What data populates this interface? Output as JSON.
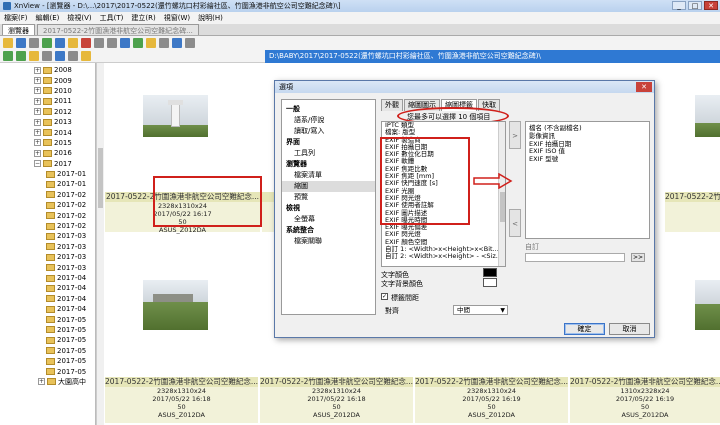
{
  "window": {
    "title": "XnView - [瀏覽器 - D:\\...\\2017\\2017-0522(還竹螺坑口村彩繪社區、竹圍漁港非航空公司空難紀念碑)\\]",
    "controls": [
      "_",
      "□",
      "✕"
    ]
  },
  "menu": [
    "檔案(F)",
    "編輯(E)",
    "檢視(V)",
    "工具(T)",
    "建立(R)",
    "視窗(W)",
    "說明(H)"
  ],
  "tabs": [
    "瀏覽器",
    "2017-0522-2竹圍漁港非航空公司空難紀念碑..."
  ],
  "address": "D:\\BABY\\2017\\2017-0522(還竹螺坑口村彩繪社區、竹圍漁港非航空公司空難紀念碑)\\",
  "tree": {
    "years": [
      "2008",
      "2009",
      "2010",
      "2011",
      "2012",
      "2013",
      "2014",
      "2015",
      "2016",
      "2017"
    ],
    "subfolders": [
      "2017-01",
      "2017-01",
      "2017-02",
      "2017-02",
      "2017-02",
      "2017-02",
      "2017-03",
      "2017-03",
      "2017-03",
      "2017-03",
      "2017-04",
      "2017-04",
      "2017-04",
      "2017-04",
      "2017-05",
      "2017-05",
      "2017-05",
      "2017-05",
      "2017-05",
      "2017-05",
      "大園高中"
    ]
  },
  "thumbnails": [
    {
      "name": "2017-0522-2竹圍漁港非航空公司空難紀念...",
      "dims": "2328x1310x24",
      "date": "2017/05/22 16:17",
      "num": "50",
      "model": "ASUS_Z012DA"
    },
    {
      "name": "2017-0522-2竹圍漁港非航空公司空難紀念...",
      "dims": "2328x1310x24",
      "date": "2017/05/22 16:18",
      "num": "50",
      "model": "ASUS_Z012DA"
    },
    {
      "name": "2017-0522-2竹圍漁港非航空公司空難紀念...",
      "dims": "2328x1310x24",
      "date": "2017/05/22 16:18",
      "num": "50",
      "model": "ASUS_Z012DA"
    },
    {
      "name": "2017-0522-2竹圍漁港非航空公司空難紀念...",
      "dims": "2328x1310x24",
      "date": "2017/05/22 16:19",
      "num": "50",
      "model": "ASUS_Z012DA"
    },
    {
      "name": "2017-0522-2竹圍漁港非航空公司空難紀念...",
      "dims": "1310x2328x24",
      "date": "2017/05/22 16:19",
      "num": "50",
      "model": "ASUS_Z012DA"
    }
  ],
  "topCaptionNames": [
    "2017-0522-2竹圍漁港非航空公司空難紀念...",
    "2017-0522-2竹圍漁港非航空公司空難紀念..."
  ],
  "dialog": {
    "title": "選項",
    "close": "✕",
    "categories": [
      {
        "label": "一般",
        "level": "top"
      },
      {
        "label": "語系/停說",
        "level": "sub"
      },
      {
        "label": "讀取/寫入",
        "level": "sub"
      },
      {
        "label": "界面",
        "level": "top"
      },
      {
        "label": "工具列",
        "level": "sub"
      },
      {
        "label": "瀏覽器",
        "level": "top"
      },
      {
        "label": "檔案清單",
        "level": "sub"
      },
      {
        "label": "縮圖",
        "level": "sub",
        "selected": true
      },
      {
        "label": "預覽",
        "level": "sub"
      },
      {
        "label": "檢視",
        "level": "top"
      },
      {
        "label": "全螢幕",
        "level": "sub"
      },
      {
        "label": "系統整合",
        "level": "top"
      },
      {
        "label": "檔案關聯",
        "level": "sub"
      }
    ],
    "tabs": [
      "外觀",
      "縮圖圖示",
      "縮圖標籤",
      "快取"
    ],
    "limitNote": "您最多可以選擇 10 個項目",
    "fieldList": [
      "IPTC 類型",
      "檔案: 版型",
      "EXIF 製造商",
      "EXIF 拍攝日期",
      "EXIF 數位化日期",
      "EXIF 軟體",
      "EXIF 焦距比數",
      "EXIF 焦距 [mm]",
      "EXIF 快門速度 [s]",
      "EXIF 光圈",
      "EXIF 閃光燈",
      "EXIF 使用者註解",
      "EXIF 圖片描述",
      "EXIF 曝光時間",
      "EXIF 曝光偏差",
      "EXIF 閃光燈",
      "EXIF 顏色空間",
      "自訂 1: <Width>x<Height>x<Bit...",
      "自訂 2: <Width>x<Height> - <Siz..."
    ],
    "selectedList": [
      "檔名 (不含副檔名)",
      "影像資訊",
      "EXIF 拍攝日期",
      "EXIF ISO 值",
      "EXIF 型號"
    ],
    "textColorLabel": "文字顏色",
    "bgColorLabel": "文字背景顏色",
    "custom": "自訂",
    "browse": ">>",
    "showFrameLabel": "標籤間距",
    "alignLabel": "對齊",
    "alignValue": "中間",
    "okLabel": "確定",
    "cancelLabel": "取消",
    "leftArrow": "<",
    "rightArrow": ">"
  }
}
